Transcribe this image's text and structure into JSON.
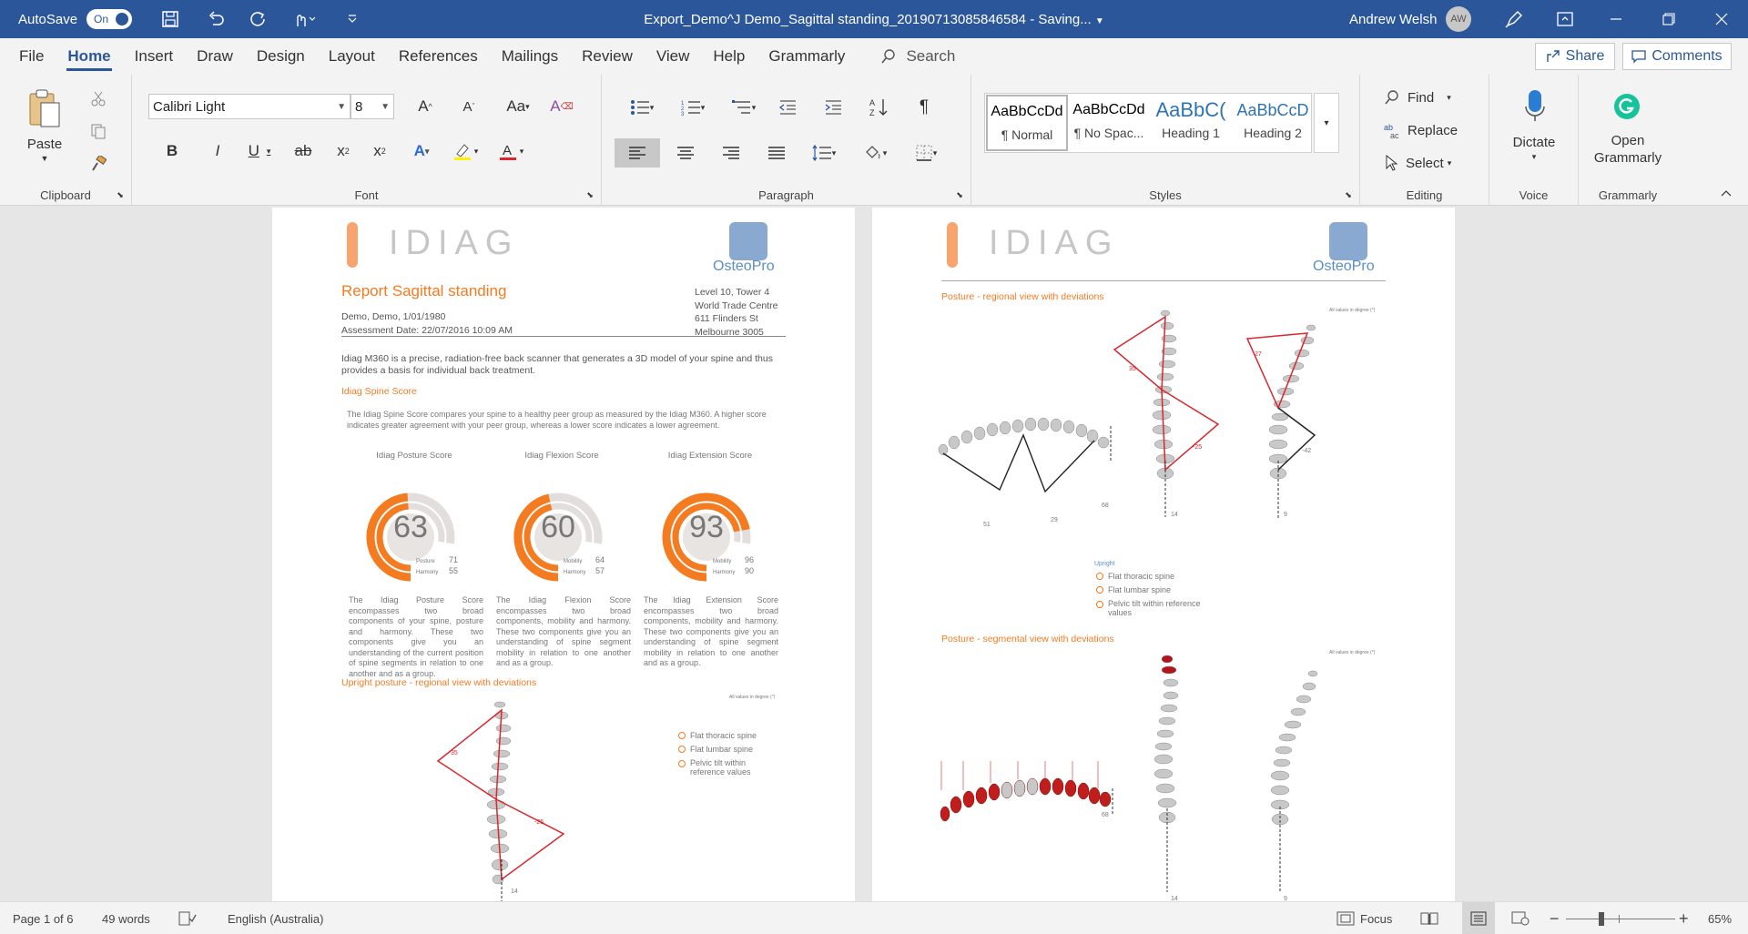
{
  "titlebar": {
    "autosave_label": "AutoSave",
    "autosave_state": "On",
    "document_title": "Export_Demo^J Demo_Sagittal standing_20190713085846584  -  Saving...",
    "user_name": "Andrew Welsh",
    "user_initials": "AW"
  },
  "tabs": [
    "File",
    "Home",
    "Insert",
    "Draw",
    "Design",
    "Layout",
    "References",
    "Mailings",
    "Review",
    "View",
    "Help",
    "Grammarly"
  ],
  "active_tab": "Home",
  "search_label": "Search",
  "share_label": "Share",
  "comments_label": "Comments",
  "ribbon": {
    "clipboard": {
      "paste_label": "Paste",
      "group_label": "Clipboard"
    },
    "font": {
      "font_name": "Calibri Light",
      "font_size": "8",
      "group_label": "Font"
    },
    "paragraph": {
      "group_label": "Paragraph"
    },
    "styles": {
      "group_label": "Styles",
      "items": [
        {
          "preview": "AaBbCcDd",
          "name": "¶ Normal"
        },
        {
          "preview": "AaBbCcDd",
          "name": "¶ No Spac..."
        },
        {
          "preview": "AaBbC(",
          "name": "Heading 1"
        },
        {
          "preview": "AaBbCcD",
          "name": "Heading 2"
        }
      ]
    },
    "editing": {
      "find_label": "Find",
      "replace_label": "Replace",
      "select_label": "Select",
      "group_label": "Editing"
    },
    "voice": {
      "dictate_label": "Dictate",
      "group_label": "Voice"
    },
    "grammarly": {
      "open_label": "Open Grammarly",
      "group_label": "Grammarly"
    }
  },
  "page1": {
    "logo_text": "IDIAG",
    "osteo_text": "OsteoPro",
    "report_title": "Report Sagittal standing",
    "patient_line": "Demo, Demo, 1/01/1980",
    "assessment_line": "Assessment Date: 22/07/2016 10:09 AM",
    "address": [
      "Level 10, Tower 4",
      "World Trade Centre",
      "611 Flinders St",
      "Melbourne 3005"
    ],
    "intro": "Idiag M360 is a precise, radiation-free back scanner that generates a 3D model of your spine and thus provides a basis for individual back treatment.",
    "spine_score_heading": "Idiag Spine Score",
    "spine_score_desc": "The Idiag Spine Score compares your spine to a healthy peer group as measured by the Idiag M360. A higher score indicates greater agreement with your peer group, whereas a lower score indicates a lower agreement.",
    "scores": [
      {
        "title": "Idiag Posture Score",
        "value": "63",
        "sub1_label": "Posture",
        "sub1_value": "71",
        "sub2_label": "Harmony",
        "sub2_value": "55",
        "fraction": 0.63,
        "desc": "The Idiag Posture Score encompasses two broad components of your spine, posture and harmony. These two components give you an understanding of the current position of spine segments in relation to one another and as a group."
      },
      {
        "title": "Idiag Flexion Score",
        "value": "60",
        "sub1_label": "Mobility",
        "sub1_value": "64",
        "sub2_label": "Harmony",
        "sub2_value": "57",
        "fraction": 0.6,
        "desc": "The Idiag Flexion Score encompasses two broad components, mobility and harmony. These two components give you an understanding of spine segment mobility in relation to one another and as a group."
      },
      {
        "title": "Idiag Extension Score",
        "value": "93",
        "sub1_label": "Mobility",
        "sub1_value": "96",
        "sub2_label": "Harmony",
        "sub2_value": "90",
        "fraction": 0.93,
        "desc": "The Idiag Extension Score encompasses two broad components, mobility and harmony. These two components give you an understanding of spine segment mobility in relation to one another and as a group."
      }
    ],
    "upright_heading": "Upright posture - regional view with deviations",
    "all_values_note": "All values in degree (°)",
    "legend": [
      "Flat thoracic spine",
      "Flat lumbar spine",
      "Pelvic tilt within reference values"
    ],
    "spine_numbers": {
      "upper": "35",
      "lower": "-25",
      "bottom": "14"
    }
  },
  "page2": {
    "logo_text": "IDIAG",
    "osteo_text": "OsteoPro",
    "regional_heading": "Posture - regional view with deviations",
    "all_values_note": "All values in degree (°)",
    "regional_numbers": {
      "a": "51",
      "b": "29",
      "c": "68",
      "d": "35",
      "e": "-25",
      "f": "14",
      "g": "27",
      "h": "-42",
      "i": "9"
    },
    "upright_label": "Upright",
    "legend": [
      "Flat thoracic spine",
      "Flat lumbar spine",
      "Pelvic tilt within reference values"
    ],
    "segmental_heading": "Posture - segmental view with deviations",
    "seg_numbers": {
      "c": "68",
      "f": "14",
      "i": "9"
    }
  },
  "statusbar": {
    "page": "Page 1 of 6",
    "words": "49 words",
    "language": "English (Australia)",
    "focus": "Focus",
    "zoom": "65%"
  },
  "colors": {
    "word_blue": "#2b579a",
    "orange": "#f47b20",
    "red": "#d9272e",
    "grey": "#c6c6c6"
  }
}
